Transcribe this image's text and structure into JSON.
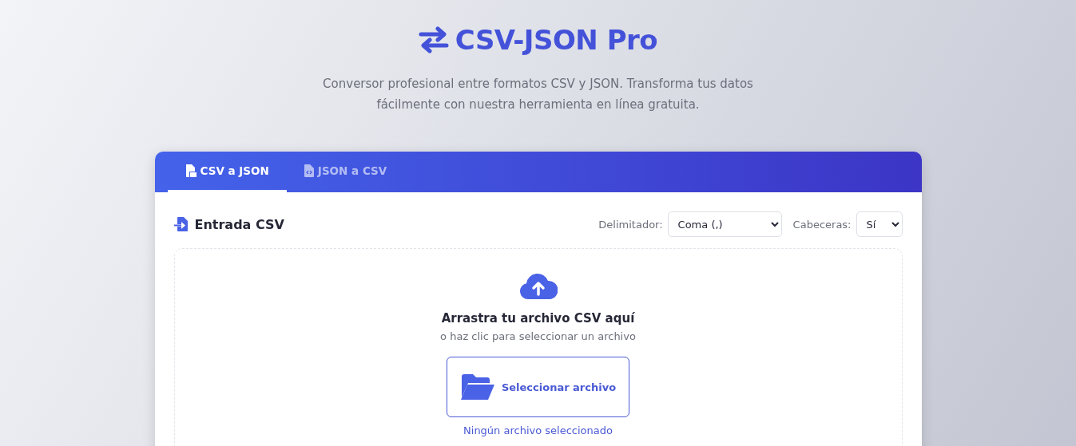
{
  "header": {
    "title": "CSV-JSON Pro",
    "subtitle": "Conversor profesional entre formatos CSV y JSON. Transforma tus datos fácilmente con nuestra herramienta en línea gratuita."
  },
  "tabs": [
    {
      "label": "CSV a JSON",
      "selected": true
    },
    {
      "label": "JSON a CSV",
      "selected": false
    }
  ],
  "input_panel": {
    "title": "Entrada CSV",
    "delimiter": {
      "label": "Delimitador:",
      "value": "Coma (,)"
    },
    "headers": {
      "label": "Cabeceras:",
      "value": "Sí"
    }
  },
  "upload": {
    "heading": "Arrastra tu archivo CSV aquí",
    "hint": "o haz clic para seleccionar un archivo",
    "button": "Seleccionar archivo",
    "file_status": "Ningún archivo seleccionado"
  }
}
